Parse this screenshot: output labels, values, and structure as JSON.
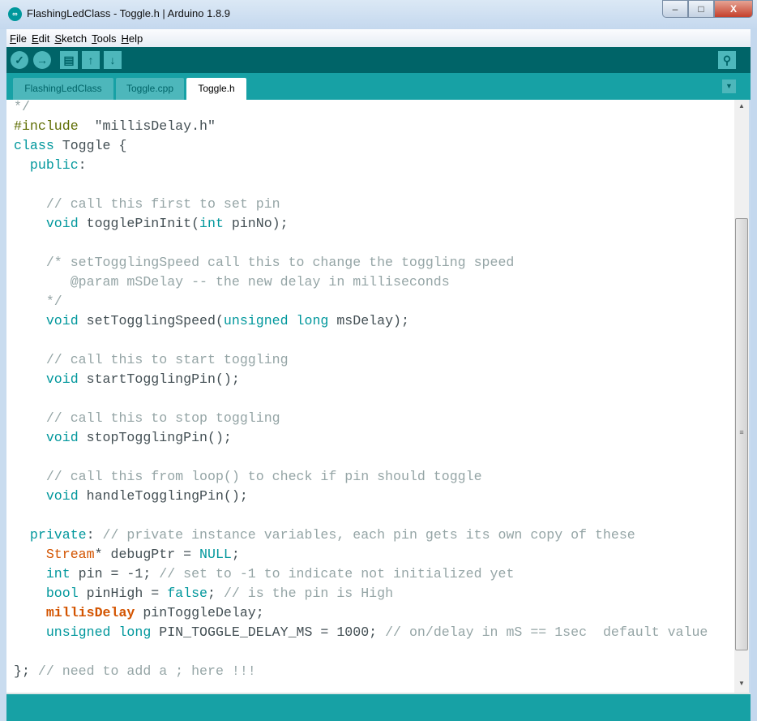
{
  "window": {
    "title": "FlashingLedClass - Toggle.h | Arduino 1.8.9",
    "icon": "arduino-logo-icon",
    "controls": {
      "minimize": "‒",
      "maximize": "□",
      "close": "X"
    }
  },
  "menu": [
    "File",
    "Edit",
    "Sketch",
    "Tools",
    "Help"
  ],
  "toolbar": {
    "verify": "✓",
    "upload": "→",
    "new": "▤",
    "open": "↑",
    "save": "↓",
    "serial_monitor": "⚲"
  },
  "tabs": [
    "FlashingLedClass",
    "Toggle.cpp",
    "Toggle.h"
  ],
  "active_tab": "Toggle.h",
  "tab_menu": "▼",
  "colors": {
    "toolbar": "#006468",
    "tabbar": "#17a1a5",
    "keyword": "#00979c",
    "comment": "#95a5a6",
    "type": "#d35400"
  },
  "code": [
    [
      [
        "c",
        "*/"
      ]
    ],
    [
      [
        "p",
        "#include"
      ],
      [
        "",
        "  \"millisDelay.h\""
      ]
    ],
    [
      [
        "k",
        "class"
      ],
      [
        "",
        " Toggle {"
      ]
    ],
    [
      [
        "",
        ""
      ],
      [
        "k",
        "  public"
      ],
      [
        "",
        ":"
      ]
    ],
    [],
    [
      [
        "c",
        "    // call this first to set pin"
      ]
    ],
    [
      [
        "k",
        "    void"
      ],
      [
        "",
        " togglePinInit("
      ],
      [
        "k",
        "int"
      ],
      [
        "",
        " pinNo);"
      ]
    ],
    [],
    [
      [
        "c",
        "    /* setTogglingSpeed call this to change the toggling speed"
      ]
    ],
    [
      [
        "c",
        "       @param mSDelay -- the new delay in milliseconds"
      ]
    ],
    [
      [
        "c",
        "    */"
      ]
    ],
    [
      [
        "k",
        "    void"
      ],
      [
        "",
        " setTogglingSpeed("
      ],
      [
        "k",
        "unsigned long"
      ],
      [
        "",
        " msDelay);"
      ]
    ],
    [],
    [
      [
        "c",
        "    // call this to start toggling"
      ]
    ],
    [
      [
        "k",
        "    void"
      ],
      [
        "",
        " startTogglingPin();"
      ]
    ],
    [],
    [
      [
        "c",
        "    // call this to stop toggling"
      ]
    ],
    [
      [
        "k",
        "    void"
      ],
      [
        "",
        " stopTogglingPin();"
      ]
    ],
    [],
    [
      [
        "c",
        "    // call this from loop() to check if pin should toggle"
      ]
    ],
    [
      [
        "k",
        "    void"
      ],
      [
        "",
        " handleTogglingPin();"
      ]
    ],
    [],
    [
      [
        "k",
        "  private"
      ],
      [
        "",
        ": "
      ],
      [
        "c",
        "// private instance variables, each pin gets its own copy of these"
      ]
    ],
    [
      [
        "t",
        "    Stream"
      ],
      [
        "",
        "* debugPtr = "
      ],
      [
        "k",
        "NULL"
      ],
      [
        "",
        ";"
      ]
    ],
    [
      [
        "k",
        "    int"
      ],
      [
        "",
        " pin = -1; "
      ],
      [
        "c",
        "// set to -1 to indicate not initialized yet"
      ]
    ],
    [
      [
        "k",
        "    bool"
      ],
      [
        "",
        " pinHigh = "
      ],
      [
        "k",
        "false"
      ],
      [
        "",
        "; "
      ],
      [
        "c",
        "// is the pin is High"
      ]
    ],
    [
      [
        "b",
        "    millisDelay"
      ],
      [
        "",
        " pinToggleDelay;"
      ]
    ],
    [
      [
        "k",
        "    unsigned long"
      ],
      [
        "",
        " PIN_TOGGLE_DELAY_MS = 1000; "
      ],
      [
        "c",
        "// on/delay in mS == 1sec  default value"
      ]
    ],
    [],
    [
      [
        "",
        "};"
      ],
      [
        "c",
        " // need to add a ; here !!!"
      ]
    ]
  ],
  "scrollbar": {
    "up": "▲",
    "down": "▼",
    "grip": "≡"
  }
}
